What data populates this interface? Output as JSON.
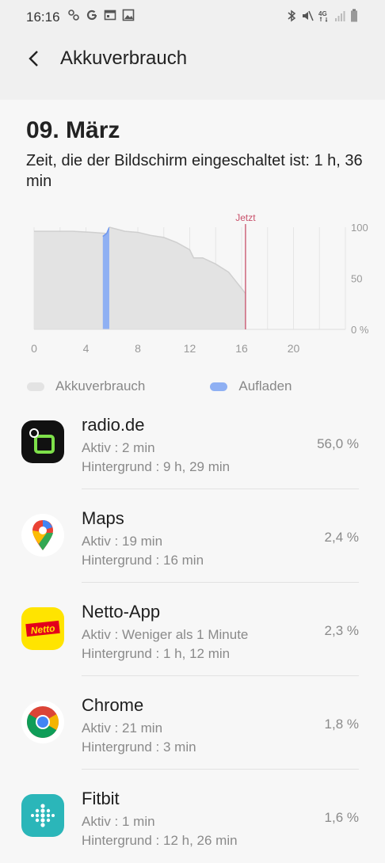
{
  "status_bar": {
    "time": "16:16"
  },
  "header": {
    "title": "Akkuverbrauch"
  },
  "summary": {
    "date": "09. März",
    "screen_time": "Zeit, die der Bildschirm eingeschaltet ist: 1 h, 36 min"
  },
  "chart_data": {
    "type": "area",
    "x_ticks": [
      "0",
      "4",
      "8",
      "12",
      "16",
      "20"
    ],
    "y_ticks": [
      "100",
      "50",
      "0 %"
    ],
    "xlim": [
      0,
      24
    ],
    "ylim": [
      0,
      100
    ],
    "now_label": "Jetzt",
    "now_x": 16.3,
    "series": [
      {
        "name": "Akkuverbrauch",
        "points": [
          [
            0,
            96
          ],
          [
            3,
            96
          ],
          [
            4.5,
            95
          ],
          [
            5.5,
            94
          ],
          [
            5.8,
            92
          ]
        ]
      },
      {
        "name": "Aufladen",
        "points": [
          [
            5.3,
            91
          ],
          [
            5.6,
            94
          ],
          [
            5.8,
            100
          ]
        ]
      },
      {
        "name": "Akkuverbrauch",
        "points": [
          [
            5.8,
            100
          ],
          [
            7,
            96
          ],
          [
            8,
            95
          ],
          [
            9,
            92
          ],
          [
            10,
            90
          ],
          [
            11,
            85
          ],
          [
            12,
            78
          ],
          [
            12.3,
            70
          ],
          [
            13,
            70
          ],
          [
            14,
            64
          ],
          [
            15,
            56
          ],
          [
            15.5,
            48
          ],
          [
            16,
            40
          ],
          [
            16.3,
            35
          ]
        ]
      }
    ],
    "colors": {
      "usage": "#e3e3e3",
      "charge": "#8fb0f3",
      "now": "#c8506a"
    }
  },
  "legend": [
    {
      "label": "Akkuverbrauch",
      "color": "#e3e3e3"
    },
    {
      "label": "Aufladen",
      "color": "#8fb0f3"
    }
  ],
  "apps": [
    {
      "name": "radio.de",
      "active": "Aktiv : 2 min",
      "background": "Hintergrund : 9 h, 29 min",
      "percent": "56,0 %",
      "icon": "radio-de-icon"
    },
    {
      "name": "Maps",
      "active": "Aktiv : 19 min",
      "background": "Hintergrund : 16 min",
      "percent": "2,4 %",
      "icon": "maps-icon"
    },
    {
      "name": "Netto-App",
      "active": "Aktiv : Weniger als 1 Minute",
      "background": "Hintergrund : 1 h, 12 min",
      "percent": "2,3 %",
      "icon": "netto-icon",
      "icon_text": "Netto"
    },
    {
      "name": "Chrome",
      "active": "Aktiv : 21 min",
      "background": "Hintergrund : 3 min",
      "percent": "1,8 %",
      "icon": "chrome-icon"
    },
    {
      "name": "Fitbit",
      "active": "Aktiv : 1 min",
      "background": "Hintergrund : 12 h, 26 min",
      "percent": "1,6 %",
      "icon": "fitbit-icon"
    }
  ]
}
